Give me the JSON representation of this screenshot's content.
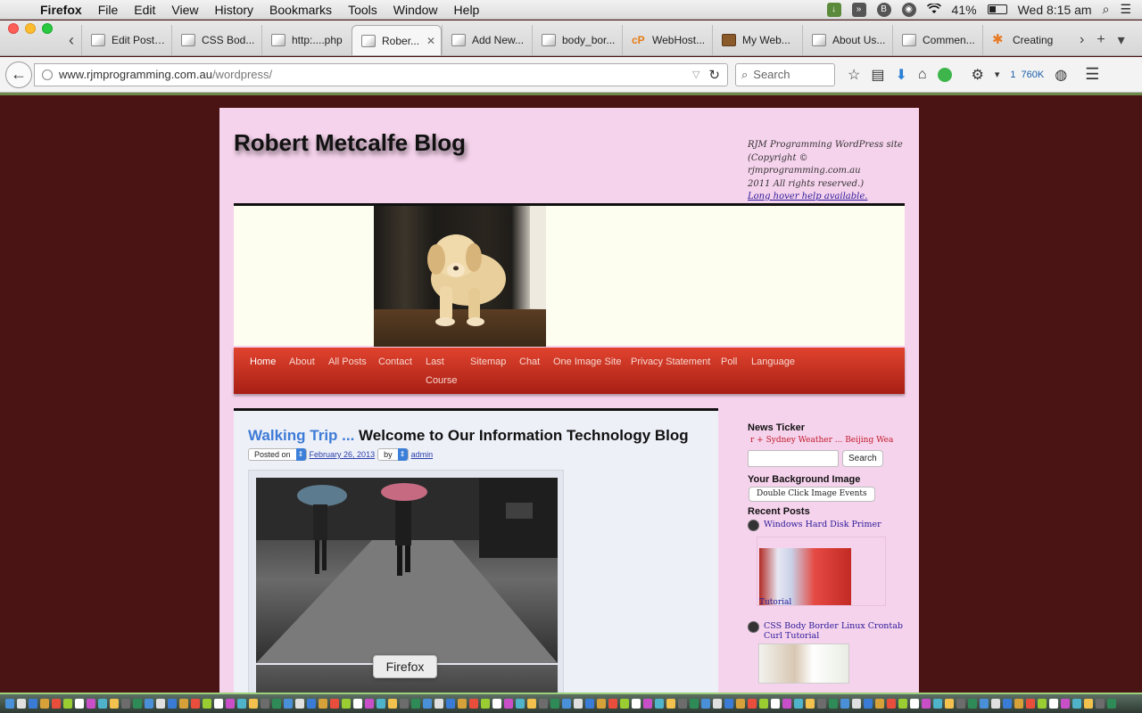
{
  "menubar": {
    "app": "Firefox",
    "items": [
      "File",
      "Edit",
      "View",
      "History",
      "Bookmarks",
      "Tools",
      "Window",
      "Help"
    ],
    "battery_percent": "41%",
    "battery_level": 0.41,
    "clock": "Wed 8:15 am"
  },
  "tabs": [
    {
      "title": "Edit Post ...",
      "icon": "page-icon"
    },
    {
      "title": "CSS Bod...",
      "icon": "page-icon"
    },
    {
      "title": "http:....php",
      "icon": "page-icon"
    },
    {
      "title": "Rober...",
      "icon": "page-icon",
      "active": true
    },
    {
      "title": "Add New...",
      "icon": "page-icon"
    },
    {
      "title": "body_bor...",
      "icon": "page-icon"
    },
    {
      "title": "WebHost...",
      "icon": "cpanel-icon"
    },
    {
      "title": "My Web...",
      "icon": "lock-icon"
    },
    {
      "title": "About Us...",
      "icon": "page-icon"
    },
    {
      "title": "Commen...",
      "icon": "page-icon"
    },
    {
      "title": "Creating",
      "icon": "star-icon"
    }
  ],
  "navbar": {
    "url_host": "www.rjmprogramming.com.au",
    "url_path": "/wordpress/",
    "search_placeholder": "Search",
    "badge_count": "1",
    "badge_size": "760K"
  },
  "site": {
    "title": "Robert Metcalfe Blog",
    "info_line1": "RJM Programming WordPress site",
    "info_line2": "(Copyright © rjmprogramming.com.au",
    "info_line3": "2011 All rights reserved.)",
    "info_link": "Long hover help available."
  },
  "nav_menu": [
    {
      "label": "Home",
      "current": true
    },
    {
      "label": "About"
    },
    {
      "label": "All Posts"
    },
    {
      "label": "Contact"
    },
    {
      "label": "Last"
    },
    {
      "label": "Course"
    },
    {
      "label": "Sitemap"
    },
    {
      "label": "Chat"
    },
    {
      "label": "One Image Site"
    },
    {
      "label": "Privacy Statement"
    },
    {
      "label": "Poll"
    },
    {
      "label": "Language"
    }
  ],
  "post": {
    "title_link": "Walking Trip ...",
    "title_rest": " Welcome to Our Information Technology Blog",
    "posted_on": "Posted on",
    "date": "February 26, 2013",
    "by": "by",
    "author": "admin"
  },
  "tooltip": "Firefox",
  "sidebar": {
    "ticker_title": "News Ticker",
    "ticker_text": "r + Sydney Weather ... Beijing Weath",
    "search_button": "Search",
    "bg_title": "Your Background Image",
    "bg_button": "Double Click Image Events",
    "recent_title": "Recent Posts",
    "recent": [
      {
        "title": "Windows Hard Disk Primer",
        "caption": "Tutorial"
      },
      {
        "title": "CSS Body Border Linux Crontab Curl Tutorial"
      }
    ]
  }
}
